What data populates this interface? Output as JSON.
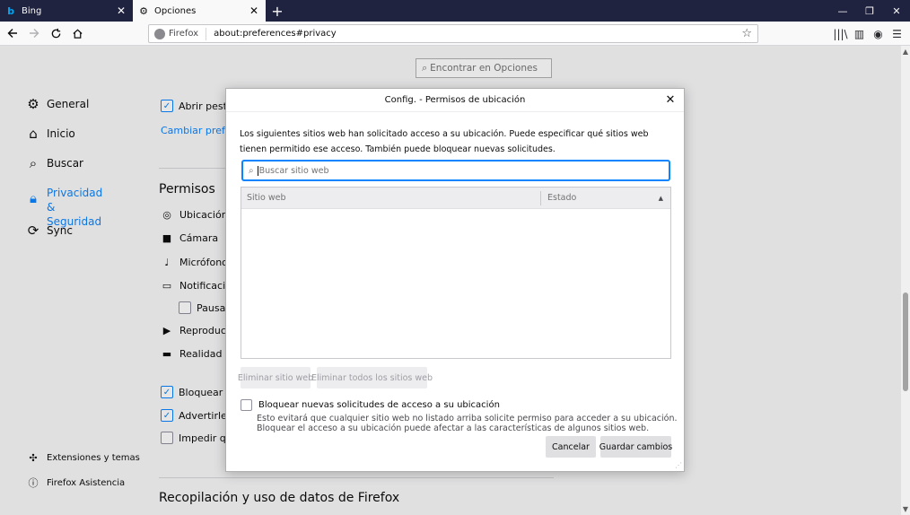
{
  "tabs": [
    {
      "label": "Bing",
      "icon": "bing-icon",
      "active": false
    },
    {
      "label": "Opciones",
      "icon": "gear-icon",
      "active": true
    }
  ],
  "navbar": {
    "identity": "Firefox",
    "url": "about:preferences#privacy"
  },
  "page": {
    "find_placeholder": "Encontrar en Opciones",
    "sidebar": {
      "items": [
        {
          "label": "General",
          "icon": "gear-icon"
        },
        {
          "label": "Inicio",
          "icon": "home-icon"
        },
        {
          "label": "Buscar",
          "icon": "search-icon"
        },
        {
          "label": "Privacidad & Seguridad",
          "icon": "lock-icon",
          "selected": true
        },
        {
          "label": "Sync",
          "icon": "sync-icon"
        }
      ],
      "extensions": "Extensiones y temas",
      "support": "Firefox Asistencia"
    },
    "main": {
      "open_tabs_checkbox": "Abrir pestañ",
      "change_prefs_link": "Cambiar prefere",
      "permissions_heading": "Permisos",
      "permissions": [
        {
          "label": "Ubicación",
          "icon": "location-icon"
        },
        {
          "label": "Cámara",
          "icon": "camera-icon"
        },
        {
          "label": "Micrófono",
          "icon": "microphone-icon"
        },
        {
          "label": "Notificacion",
          "icon": "notification-icon"
        }
      ],
      "pause_checkbox": "Pausar n",
      "more_permissions": [
        {
          "label": "Reproducció",
          "icon": "autoplay-icon"
        },
        {
          "label": "Realidad virt",
          "icon": "vr-icon"
        }
      ],
      "block_popups": "Bloquear ven",
      "warn_addons": "Advertirle cu",
      "prevent": "Impedir que",
      "data_heading": "Recopilación y uso de datos de Firefox"
    }
  },
  "dialog": {
    "title": "Config. - Permisos de ubicación",
    "description": "Los siguientes sitios web han solicitado acceso a su ubicación. Puede especificar qué sitios web tienen permitido ese acceso. También puede bloquear nuevas solicitudes.",
    "search_placeholder": "Buscar sitio web",
    "columns": {
      "site": "Sitio web",
      "state": "Estado"
    },
    "remove_site": "Eliminar sitio web",
    "remove_all": "Eliminar todos los sitios web",
    "block_label": "Bloquear nuevas solicitudes de acceso a su ubicación",
    "block_note": "Esto evitará que cualquier sitio web no listado arriba solicite permiso para acceder a su ubicación. Bloquear el acceso a su ubicación puede afectar a las características de algunos sitios web.",
    "cancel": "Cancelar",
    "save": "Guardar cambios"
  }
}
